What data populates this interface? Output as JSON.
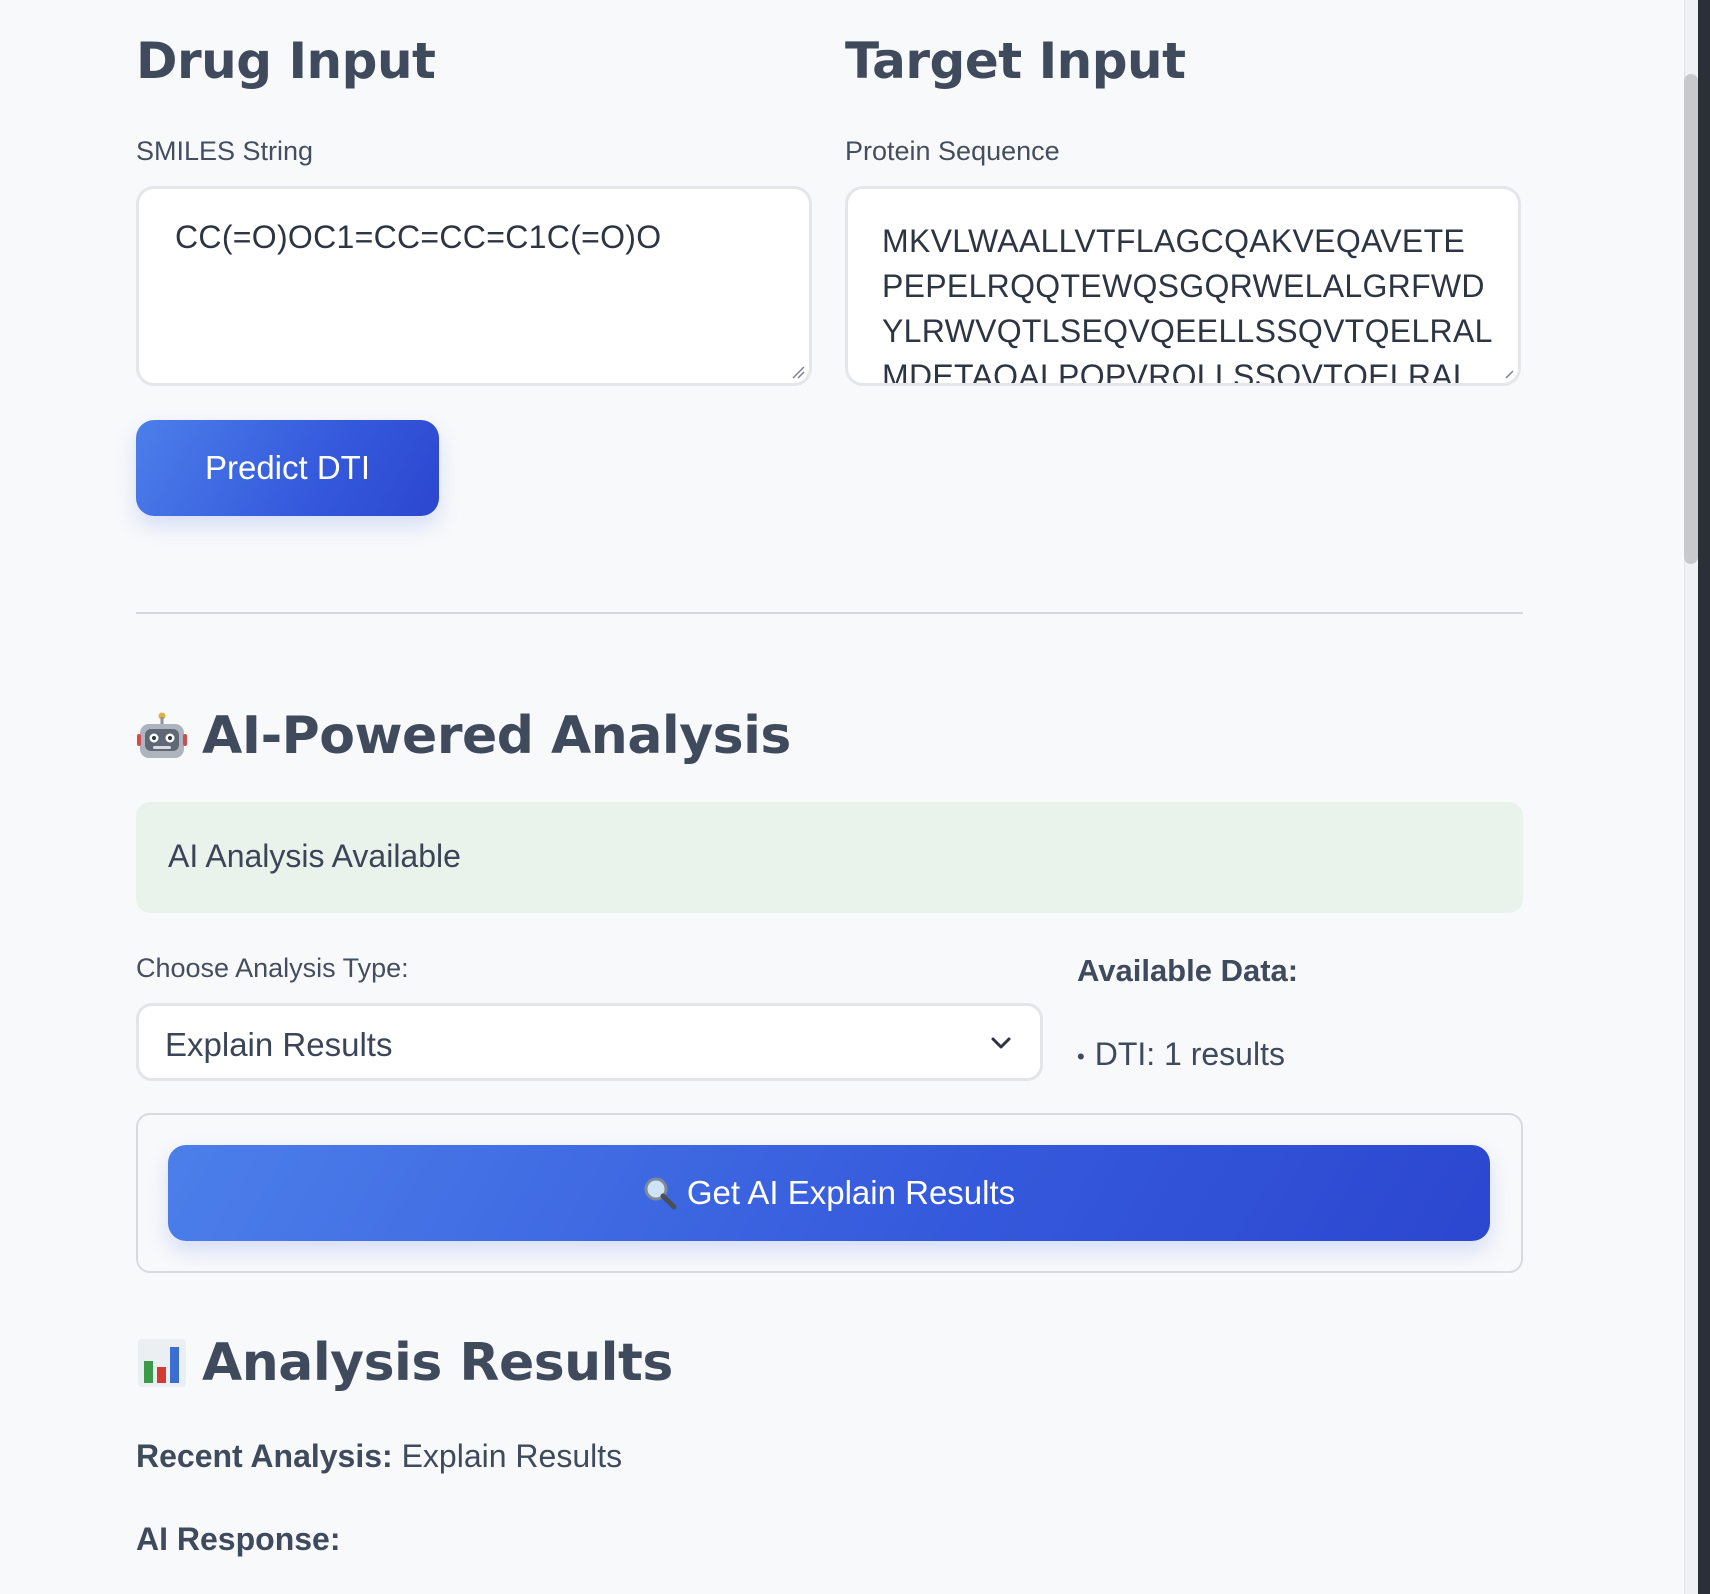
{
  "drug_input": {
    "title": "Drug Input",
    "smiles_label": "SMILES String",
    "smiles_value": "CC(=O)OC1=CC=CC=C1C(=O)O"
  },
  "target_input": {
    "title": "Target Input",
    "protein_label": "Protein Sequence",
    "protein_lines": [
      "MKVLWAALLVTFLAGCQAKVEQAVETE",
      "PEPELRQQTEWQSGQRWELALGRFWD",
      "YLRWVQTLSEQVQEELLSSQVTQELRAL",
      "MDETAQALPQPVRQLLSSQVTQELRAL"
    ]
  },
  "predict_button": {
    "label": "Predict DTI"
  },
  "ai_analysis": {
    "icon": "robot-icon",
    "title": "AI-Powered Analysis",
    "status_text": "AI Analysis Available",
    "choose_label": "Choose Analysis Type:",
    "selected_option": "Explain Results",
    "available_data_label": "Available Data:",
    "available_data_items": [
      "DTI: 1 results"
    ],
    "get_button": {
      "icon": "magnifier-icon",
      "label": "Get AI Explain Results"
    }
  },
  "analysis_results": {
    "icon": "bar-chart-icon",
    "title": "Analysis Results",
    "recent_label": "Recent Analysis:",
    "recent_value": "Explain Results",
    "ai_response_label": "AI Response:"
  },
  "colors": {
    "accent": "#3559dc",
    "status_bg": "#e9f3ec",
    "page_bg": "#f8f9fb"
  }
}
